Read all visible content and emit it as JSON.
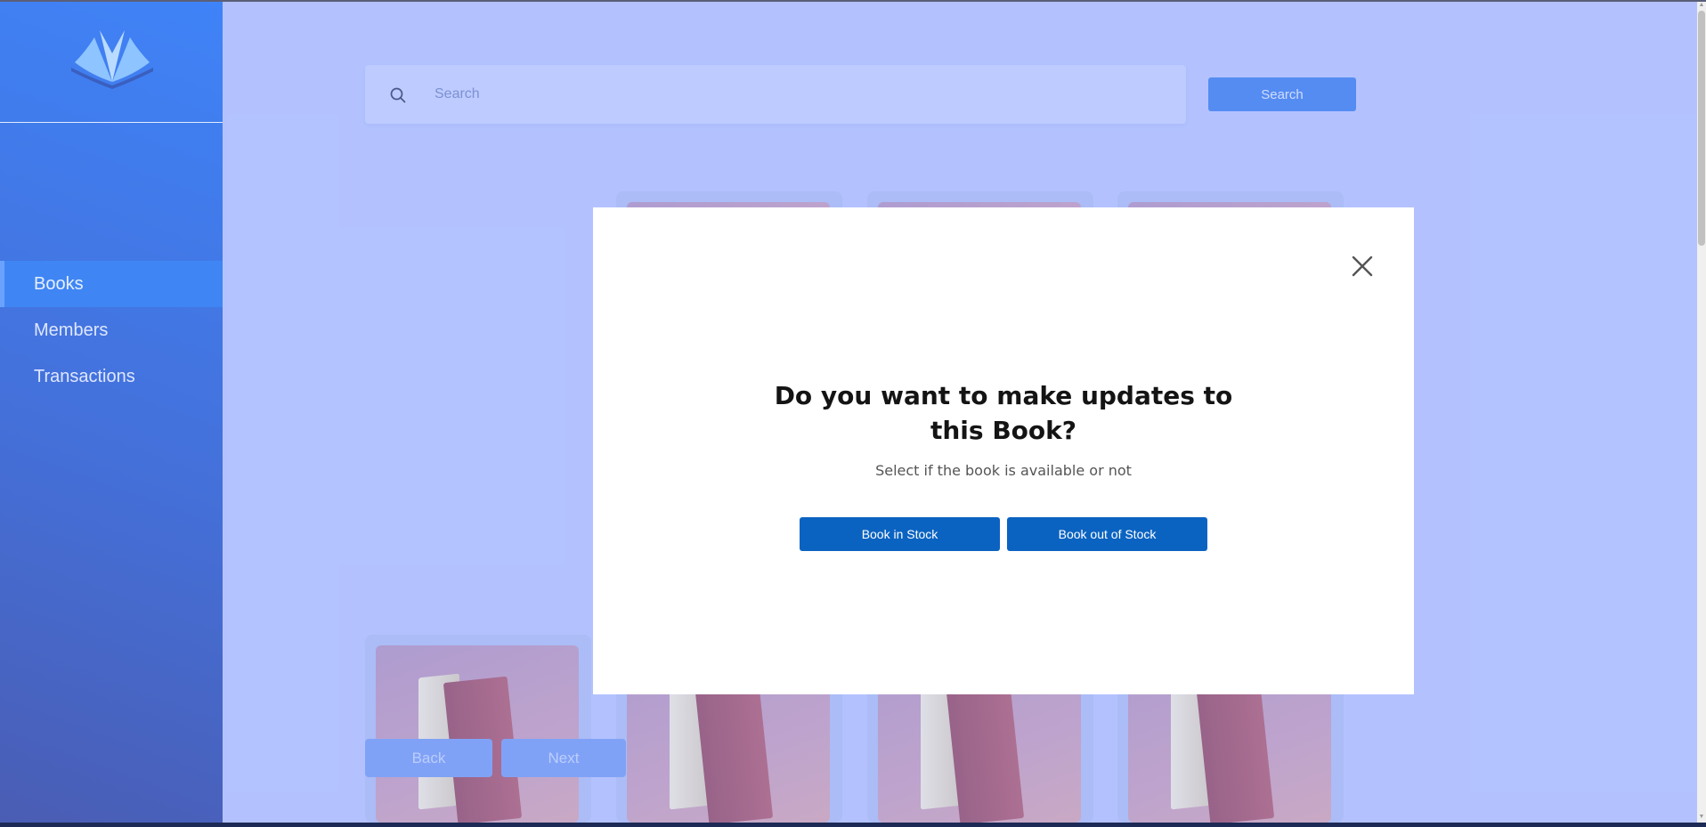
{
  "sidebar": {
    "logo": "open-book-logo-icon",
    "items": [
      {
        "label": "Books",
        "active": true
      },
      {
        "label": "Members",
        "active": false
      },
      {
        "label": "Transactions",
        "active": false
      }
    ]
  },
  "search": {
    "placeholder": "Search",
    "value": "",
    "button_label": "Search",
    "icon": "search-icon"
  },
  "pagination": {
    "back_label": "Back",
    "next_label": "Next"
  },
  "modal": {
    "title_line1": "Do you want to make updates to",
    "title_line2": "this Book?",
    "subtitle": "Select if the book is available or not",
    "in_stock_label": "Book in Stock",
    "out_of_stock_label": "Book out of Stock",
    "close_icon": "close-icon"
  },
  "colors": {
    "sidebar": "#4470d9",
    "background": "#bcc9ff",
    "accent": "#0b63c1",
    "search_button": "#4a87f0"
  }
}
